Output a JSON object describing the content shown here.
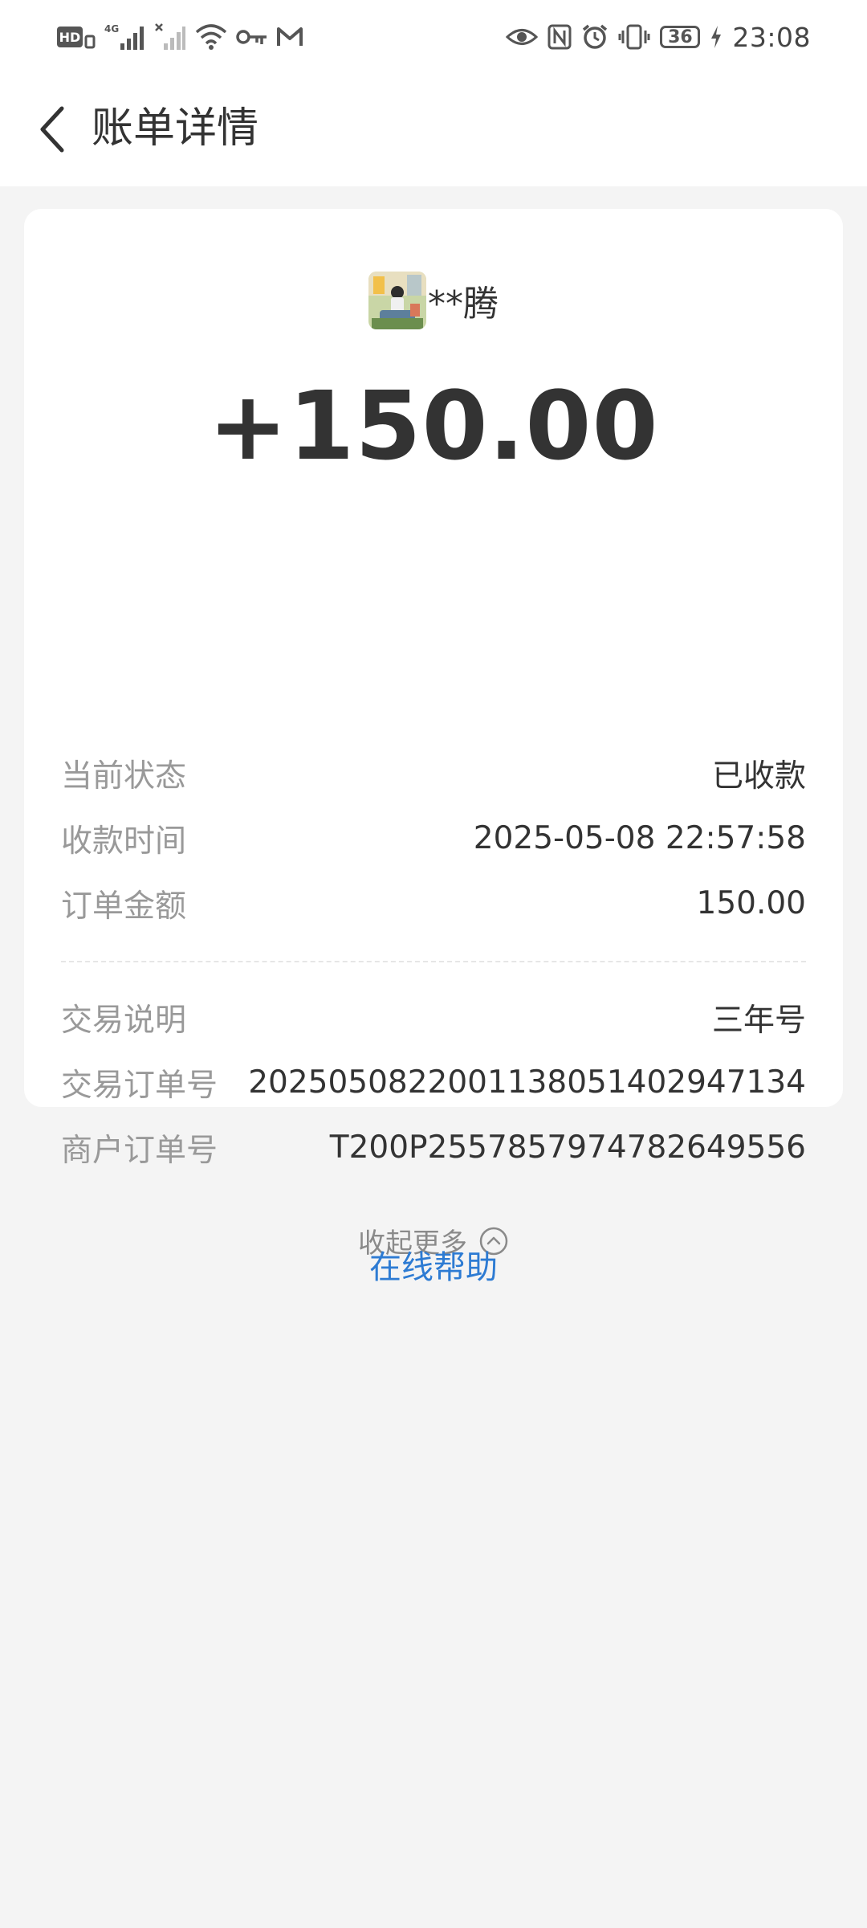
{
  "status_bar": {
    "left_icons": [
      "hd-volte-icon",
      "4g-signal-icon",
      "no-signal-icon",
      "wifi-icon",
      "vpn-key-icon",
      "gmail-icon"
    ],
    "right_icons": [
      "eye-icon",
      "nfc-icon",
      "alarm-icon",
      "vibrate-icon"
    ],
    "battery_level": "36",
    "time": "23:08"
  },
  "header": {
    "title": "账单详情"
  },
  "payer": {
    "name": "**腾"
  },
  "amount": "+150.00",
  "details_top": [
    {
      "label": "当前状态",
      "value": "已收款"
    },
    {
      "label": "收款时间",
      "value": "2025-05-08 22:57:58"
    },
    {
      "label": "订单金额",
      "value": "150.00"
    }
  ],
  "details_bottom": [
    {
      "label": "交易说明",
      "value": "三年号"
    },
    {
      "label": "交易订单号",
      "value": "2025050822001138051402947134"
    },
    {
      "label": "商户订单号",
      "value": "T200P2557857974782649556"
    }
  ],
  "collapse_label": "收起更多",
  "help_label": "在线帮助",
  "colors": {
    "background": "#f4f4f4",
    "card": "#ffffff",
    "text_primary": "#333333",
    "text_secondary": "#999999",
    "link": "#2d7bd3"
  }
}
